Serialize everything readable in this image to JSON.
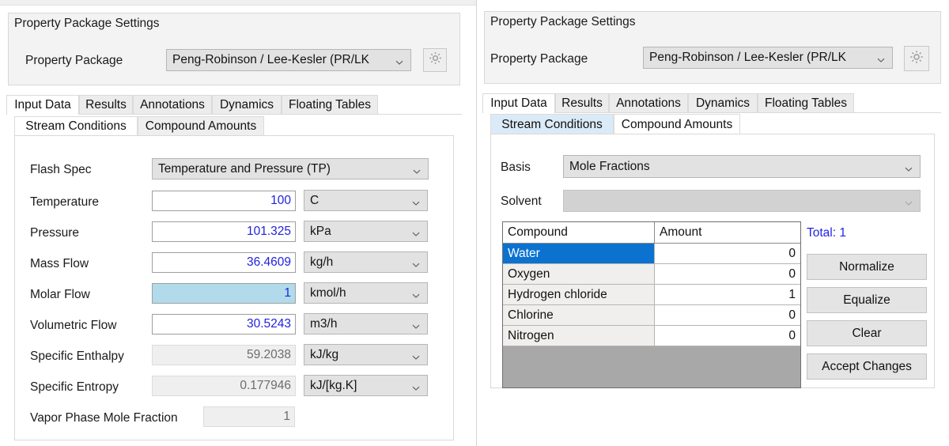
{
  "panels": {
    "left": {
      "groupbox": {
        "title": "Property Package Settings"
      },
      "property_package": {
        "label": "Property Package",
        "value": "Peng-Robinson / Lee-Kesler (PR/LK",
        "settings_icon": "gear-icon"
      },
      "outer_tabs": [
        {
          "label": "Input Data",
          "active": true
        },
        {
          "label": "Results",
          "active": false
        },
        {
          "label": "Annotations",
          "active": false
        },
        {
          "label": "Dynamics",
          "active": false
        },
        {
          "label": "Floating Tables",
          "active": false
        }
      ],
      "inner_tabs": [
        {
          "label": "Stream Conditions",
          "state": "active"
        },
        {
          "label": "Compound Amounts",
          "state": "inactive"
        }
      ],
      "flash_spec": {
        "label": "Flash Spec",
        "value": "Temperature and Pressure (TP)"
      },
      "rows": [
        {
          "label": "Temperature",
          "value": "100",
          "unit": "C",
          "state": "editable"
        },
        {
          "label": "Pressure",
          "value": "101.325",
          "unit": "kPa",
          "state": "editable"
        },
        {
          "label": "Mass Flow",
          "value": "36.4609",
          "unit": "kg/h",
          "state": "editable"
        },
        {
          "label": "Molar Flow",
          "value": "1",
          "unit": "kmol/h",
          "state": "focused"
        },
        {
          "label": "Volumetric Flow",
          "value": "30.5243",
          "unit": "m3/h",
          "state": "editable"
        },
        {
          "label": "Specific Enthalpy",
          "value": "59.2038",
          "unit": "kJ/kg",
          "state": "readonly"
        },
        {
          "label": "Specific Entropy",
          "value": "0.177946",
          "unit": "kJ/[kg.K]",
          "state": "readonly"
        }
      ],
      "vapor_fraction": {
        "label": "Vapor Phase Mole Fraction",
        "value": "1",
        "state": "readonly"
      }
    },
    "right": {
      "groupbox": {
        "title": "Property Package Settings"
      },
      "property_package": {
        "label": "Property Package",
        "value": "Peng-Robinson / Lee-Kesler (PR/LK",
        "settings_icon": "gear-icon"
      },
      "outer_tabs": [
        {
          "label": "Input Data",
          "active": true
        },
        {
          "label": "Results",
          "active": false
        },
        {
          "label": "Annotations",
          "active": false
        },
        {
          "label": "Dynamics",
          "active": false
        },
        {
          "label": "Floating Tables",
          "active": false
        }
      ],
      "inner_tabs": [
        {
          "label": "Stream Conditions",
          "state": "hover"
        },
        {
          "label": "Compound Amounts",
          "state": "active"
        }
      ],
      "basis": {
        "label": "Basis",
        "value": "Mole Fractions"
      },
      "solvent": {
        "label": "Solvent",
        "value": "",
        "state": "disabled"
      },
      "table": {
        "columns": [
          "Compound",
          "Amount"
        ],
        "rows": [
          {
            "compound": "Water",
            "amount": "0",
            "selected": true
          },
          {
            "compound": "Oxygen",
            "amount": "0",
            "selected": false
          },
          {
            "compound": "Hydrogen chloride",
            "amount": "1",
            "selected": false
          },
          {
            "compound": "Chlorine",
            "amount": "0",
            "selected": false
          },
          {
            "compound": "Nitrogen",
            "amount": "0",
            "selected": false
          }
        ]
      },
      "total": "Total: 1",
      "buttons": [
        {
          "label": "Normalize"
        },
        {
          "label": "Equalize"
        },
        {
          "label": "Clear"
        },
        {
          "label": "Accept Changes"
        }
      ]
    }
  },
  "colors": {
    "accent_selection": "#0b72d0",
    "value_blue": "#2222dd",
    "focused_field": "#b1dbea",
    "tab_hover": "#dbeaf7",
    "grid_empty": "#a8a8a8"
  }
}
